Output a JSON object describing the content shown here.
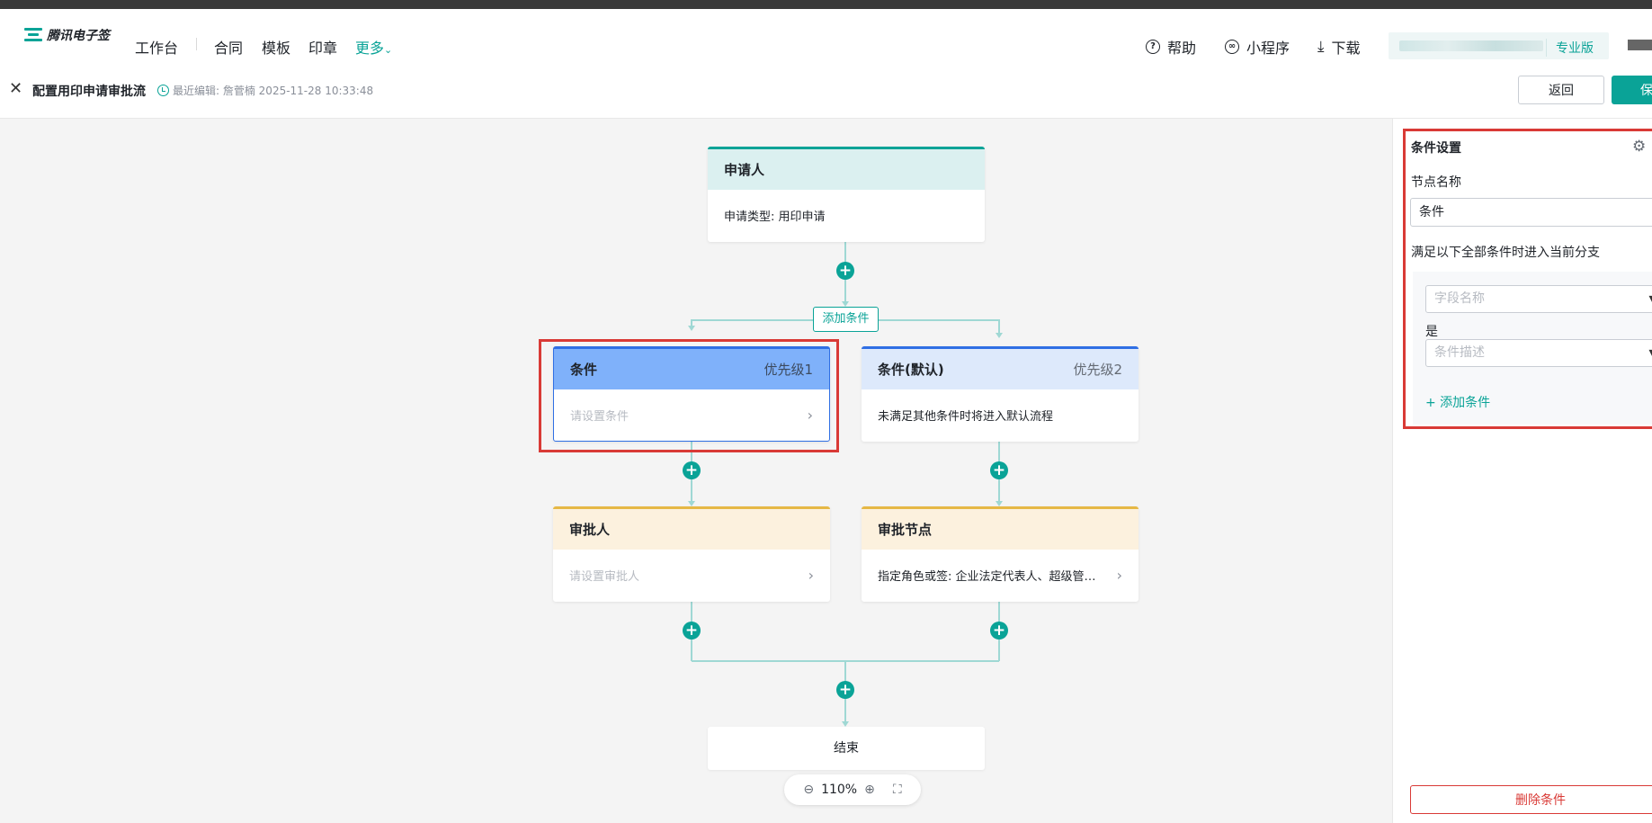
{
  "app": {
    "logo_text": "腾讯电子签"
  },
  "nav": {
    "items": [
      "工作台",
      "合同",
      "模板",
      "印章"
    ],
    "more_label": "更多",
    "help_label": "帮助",
    "mini_program_label": "小程序",
    "download_label": "下载",
    "edition_badge": "专业版"
  },
  "subheader": {
    "title": "配置用印申请审批流",
    "edit_info": "最近编辑: 詹菅楠 2025-11-28 10:33:48",
    "back_label": "返回",
    "save_label": "保"
  },
  "flow": {
    "applicant": {
      "title": "申请人",
      "body": "申请类型: 用印申请"
    },
    "add_condition_label": "添加条件",
    "condition_1": {
      "title": "条件",
      "priority": "优先级1",
      "placeholder": "请设置条件"
    },
    "condition_default": {
      "title": "条件(默认)",
      "priority": "优先级2",
      "body": "未满足其他条件时将进入默认流程"
    },
    "approver": {
      "title": "审批人",
      "placeholder": "请设置审批人"
    },
    "approval_node": {
      "title": "审批节点",
      "body": "指定角色或签: 企业法定代表人、超级管…"
    },
    "end_label": "结束",
    "zoom_level": "110%",
    "colors": {
      "accent": "#0aa397",
      "selected_head": "#7fb1fa",
      "condition_head": "#dde9fb",
      "approver_head": "#fcf1de",
      "applicant_head": "#dbf0f0",
      "highlight": "#d93a36"
    }
  },
  "panel": {
    "title": "条件设置",
    "node_name_label": "节点名称",
    "node_name_value": "条件",
    "rule_hint": "满足以下全部条件时进入当前分支",
    "field_placeholder": "字段名称",
    "operator_label": "是",
    "value_placeholder": "条件描述",
    "add_condition_link": "+ 添加条件",
    "delete_label": "删除条件"
  }
}
